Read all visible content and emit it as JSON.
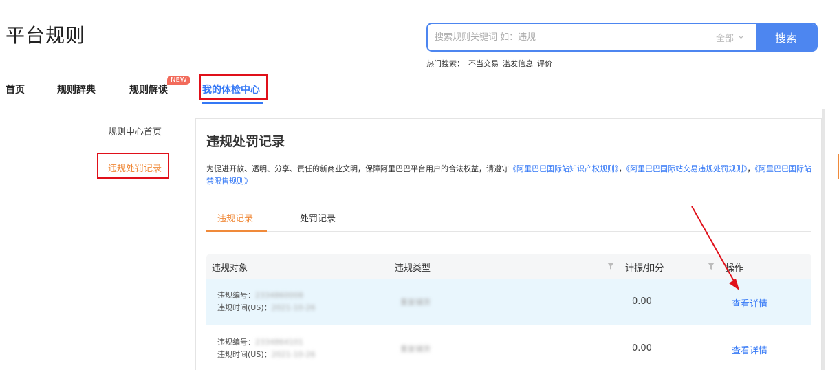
{
  "header": {
    "title": "平台规则",
    "search": {
      "placeholder": "搜索规则关键词 如：违规",
      "scope": "全部",
      "button": "搜索"
    },
    "hot": {
      "label": "热门搜索：",
      "items": [
        "不当交易",
        "滥发信息",
        "评价"
      ]
    }
  },
  "nav": {
    "items": [
      {
        "label": "首页"
      },
      {
        "label": "规则辞典"
      },
      {
        "label": "规则解读",
        "badge": "NEW"
      },
      {
        "label": "我的体检中心",
        "active": true
      }
    ]
  },
  "sidebar": {
    "items": [
      {
        "label": "规则中心首页"
      },
      {
        "label": "违规处罚记录",
        "active": true
      }
    ]
  },
  "panel": {
    "title": "违规处罚记录",
    "desc_prefix": "为促进开放、透明、分享、责任的新商业文明，保障阿里巴巴平台用户的合法权益，请遵守",
    "links": [
      "《阿里巴巴国际站知识产权规则》",
      "《阿里巴巴国际站交易违规处罚规则》",
      "《阿里巴巴国际站禁限售规则》"
    ],
    "sep": "，",
    "tabs": [
      {
        "label": "违规记录",
        "active": true
      },
      {
        "label": "处罚记录"
      }
    ],
    "table": {
      "headers": [
        "违规对象",
        "违规类型",
        "计振/扣分",
        "操作"
      ],
      "rows": [
        {
          "id_label": "违规编号：",
          "id_value": "2334860008",
          "time_label": "违规时间(US)：",
          "time_value": "2021-10-26",
          "type": "重复铺货",
          "score": "0.00",
          "action": "查看详情"
        },
        {
          "id_label": "违规编号：",
          "id_value": "2334864101",
          "time_label": "违规时间(US)：",
          "time_value": "2021-10-26",
          "type": "重复铺货",
          "score": "0.00",
          "action": "查看详情"
        }
      ]
    }
  },
  "colors": {
    "accent_blue": "#3478f6",
    "accent_orange": "#f08a3a",
    "annotation_red": "#e0101a"
  }
}
